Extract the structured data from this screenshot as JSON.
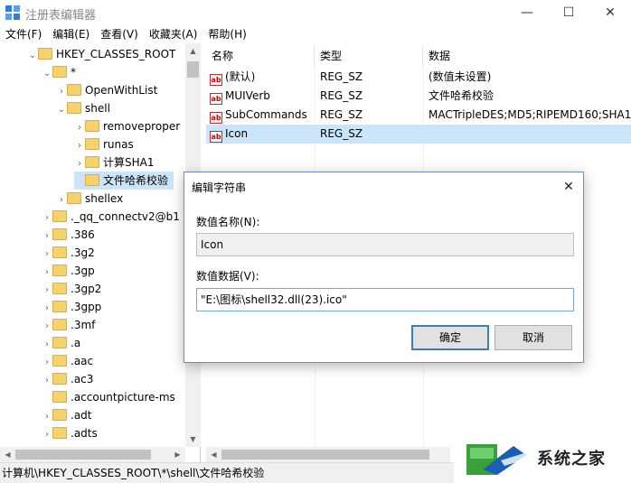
{
  "window": {
    "title": "注册表编辑器",
    "min": "—",
    "max": "☐",
    "close": "✕"
  },
  "menu": [
    "文件(F)",
    "编辑(E)",
    "查看(V)",
    "收藏夹(A)",
    "帮助(H)"
  ],
  "tree": [
    {
      "label": "HKEY_CLASSES_ROOT",
      "level": 0,
      "chev": "⌄"
    },
    {
      "label": "*",
      "level": 1,
      "chev": "⌄"
    },
    {
      "label": "OpenWithList",
      "level": 2,
      "chev": "›"
    },
    {
      "label": "shell",
      "level": 2,
      "chev": "⌄"
    },
    {
      "label": "removeproper",
      "level": 3,
      "chev": "›"
    },
    {
      "label": "runas",
      "level": 3,
      "chev": "›"
    },
    {
      "label": "计算SHA1",
      "level": 3,
      "chev": "›"
    },
    {
      "label": "文件哈希校验",
      "level": 3,
      "chev": "",
      "selected": true
    },
    {
      "label": "shellex",
      "level": 2,
      "chev": "›"
    },
    {
      "label": "._qq_connectv2@b1",
      "level": 1,
      "chev": "›"
    },
    {
      "label": ".386",
      "level": 1,
      "chev": "›"
    },
    {
      "label": ".3g2",
      "level": 1,
      "chev": "›"
    },
    {
      "label": ".3gp",
      "level": 1,
      "chev": "›"
    },
    {
      "label": ".3gp2",
      "level": 1,
      "chev": "›"
    },
    {
      "label": ".3gpp",
      "level": 1,
      "chev": "›"
    },
    {
      "label": ".3mf",
      "level": 1,
      "chev": "›"
    },
    {
      "label": ".a",
      "level": 1,
      "chev": "›"
    },
    {
      "label": ".aac",
      "level": 1,
      "chev": "›"
    },
    {
      "label": ".ac3",
      "level": 1,
      "chev": "›"
    },
    {
      "label": ".accountpicture-ms",
      "level": 1,
      "chev": ""
    },
    {
      "label": ".adt",
      "level": 1,
      "chev": "›"
    },
    {
      "label": ".adts",
      "level": 1,
      "chev": "›"
    }
  ],
  "list": {
    "headers": [
      "名称",
      "类型",
      "数据"
    ],
    "rows": [
      {
        "name": "(默认)",
        "type": "REG_SZ",
        "data": "(数值未设置)"
      },
      {
        "name": "MUIVerb",
        "type": "REG_SZ",
        "data": "文件哈希校验"
      },
      {
        "name": "SubCommands",
        "type": "REG_SZ",
        "data": "MACTripleDES;MD5;RIPEMD160;SHA1;"
      },
      {
        "name": "Icon",
        "type": "REG_SZ",
        "data": "",
        "selected": true
      }
    ]
  },
  "status": "计算机\\HKEY_CLASSES_ROOT\\*\\shell\\文件哈希校验",
  "watermark": {
    "text": "系统之家"
  },
  "dialog": {
    "title": "编辑字符串",
    "close": "✕",
    "name_label": "数值名称(N):",
    "name_value": "Icon",
    "data_label": "数值数据(V):",
    "data_value": "\"E:\\图标\\shell32.dll(23).ico\"",
    "ok": "确定",
    "cancel": "取消"
  }
}
